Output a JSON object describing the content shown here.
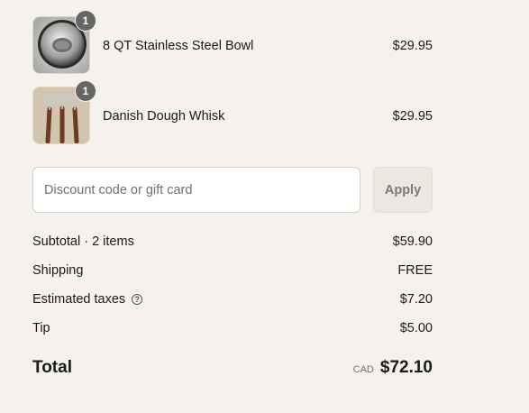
{
  "line_items": [
    {
      "name": "8 QT Stainless Steel Bowl",
      "price": "$29.95",
      "quantity": "1",
      "image_icon": "steel-bowl-image"
    },
    {
      "name": "Danish Dough Whisk",
      "price": "$29.95",
      "quantity": "1",
      "image_icon": "dough-whisk-image"
    }
  ],
  "discount": {
    "placeholder": "Discount code or gift card",
    "apply_label": "Apply"
  },
  "totals": {
    "subtotal_label": "Subtotal · 2 items",
    "subtotal_value": "$59.90",
    "shipping_label": "Shipping",
    "shipping_value": "FREE",
    "taxes_label": "Estimated taxes",
    "taxes_value": "$7.20",
    "tip_label": "Tip",
    "tip_value": "$5.00",
    "total_label": "Total",
    "currency": "CAD",
    "total_value": "$72.10"
  },
  "colors": {
    "background": "#f5f2ed",
    "badge": "#666666",
    "apply_button_bg": "#ece8e1"
  }
}
